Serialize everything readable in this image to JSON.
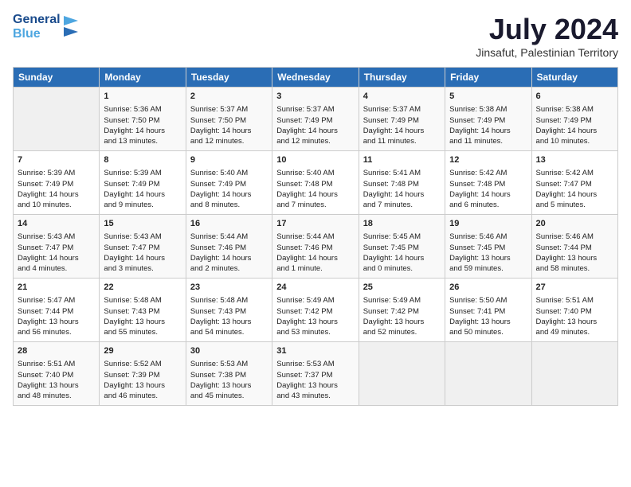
{
  "header": {
    "logo_line1": "General",
    "logo_line2": "Blue",
    "month_year": "July 2024",
    "location": "Jinsafut, Palestinian Territory"
  },
  "days_of_week": [
    "Sunday",
    "Monday",
    "Tuesday",
    "Wednesday",
    "Thursday",
    "Friday",
    "Saturday"
  ],
  "weeks": [
    [
      {
        "day": "",
        "content": ""
      },
      {
        "day": "1",
        "content": "Sunrise: 5:36 AM\nSunset: 7:50 PM\nDaylight: 14 hours\nand 13 minutes."
      },
      {
        "day": "2",
        "content": "Sunrise: 5:37 AM\nSunset: 7:50 PM\nDaylight: 14 hours\nand 12 minutes."
      },
      {
        "day": "3",
        "content": "Sunrise: 5:37 AM\nSunset: 7:49 PM\nDaylight: 14 hours\nand 12 minutes."
      },
      {
        "day": "4",
        "content": "Sunrise: 5:37 AM\nSunset: 7:49 PM\nDaylight: 14 hours\nand 11 minutes."
      },
      {
        "day": "5",
        "content": "Sunrise: 5:38 AM\nSunset: 7:49 PM\nDaylight: 14 hours\nand 11 minutes."
      },
      {
        "day": "6",
        "content": "Sunrise: 5:38 AM\nSunset: 7:49 PM\nDaylight: 14 hours\nand 10 minutes."
      }
    ],
    [
      {
        "day": "7",
        "content": "Sunrise: 5:39 AM\nSunset: 7:49 PM\nDaylight: 14 hours\nand 10 minutes."
      },
      {
        "day": "8",
        "content": "Sunrise: 5:39 AM\nSunset: 7:49 PM\nDaylight: 14 hours\nand 9 minutes."
      },
      {
        "day": "9",
        "content": "Sunrise: 5:40 AM\nSunset: 7:49 PM\nDaylight: 14 hours\nand 8 minutes."
      },
      {
        "day": "10",
        "content": "Sunrise: 5:40 AM\nSunset: 7:48 PM\nDaylight: 14 hours\nand 7 minutes."
      },
      {
        "day": "11",
        "content": "Sunrise: 5:41 AM\nSunset: 7:48 PM\nDaylight: 14 hours\nand 7 minutes."
      },
      {
        "day": "12",
        "content": "Sunrise: 5:42 AM\nSunset: 7:48 PM\nDaylight: 14 hours\nand 6 minutes."
      },
      {
        "day": "13",
        "content": "Sunrise: 5:42 AM\nSunset: 7:47 PM\nDaylight: 14 hours\nand 5 minutes."
      }
    ],
    [
      {
        "day": "14",
        "content": "Sunrise: 5:43 AM\nSunset: 7:47 PM\nDaylight: 14 hours\nand 4 minutes."
      },
      {
        "day": "15",
        "content": "Sunrise: 5:43 AM\nSunset: 7:47 PM\nDaylight: 14 hours\nand 3 minutes."
      },
      {
        "day": "16",
        "content": "Sunrise: 5:44 AM\nSunset: 7:46 PM\nDaylight: 14 hours\nand 2 minutes."
      },
      {
        "day": "17",
        "content": "Sunrise: 5:44 AM\nSunset: 7:46 PM\nDaylight: 14 hours\nand 1 minute."
      },
      {
        "day": "18",
        "content": "Sunrise: 5:45 AM\nSunset: 7:45 PM\nDaylight: 14 hours\nand 0 minutes."
      },
      {
        "day": "19",
        "content": "Sunrise: 5:46 AM\nSunset: 7:45 PM\nDaylight: 13 hours\nand 59 minutes."
      },
      {
        "day": "20",
        "content": "Sunrise: 5:46 AM\nSunset: 7:44 PM\nDaylight: 13 hours\nand 58 minutes."
      }
    ],
    [
      {
        "day": "21",
        "content": "Sunrise: 5:47 AM\nSunset: 7:44 PM\nDaylight: 13 hours\nand 56 minutes."
      },
      {
        "day": "22",
        "content": "Sunrise: 5:48 AM\nSunset: 7:43 PM\nDaylight: 13 hours\nand 55 minutes."
      },
      {
        "day": "23",
        "content": "Sunrise: 5:48 AM\nSunset: 7:43 PM\nDaylight: 13 hours\nand 54 minutes."
      },
      {
        "day": "24",
        "content": "Sunrise: 5:49 AM\nSunset: 7:42 PM\nDaylight: 13 hours\nand 53 minutes."
      },
      {
        "day": "25",
        "content": "Sunrise: 5:49 AM\nSunset: 7:42 PM\nDaylight: 13 hours\nand 52 minutes."
      },
      {
        "day": "26",
        "content": "Sunrise: 5:50 AM\nSunset: 7:41 PM\nDaylight: 13 hours\nand 50 minutes."
      },
      {
        "day": "27",
        "content": "Sunrise: 5:51 AM\nSunset: 7:40 PM\nDaylight: 13 hours\nand 49 minutes."
      }
    ],
    [
      {
        "day": "28",
        "content": "Sunrise: 5:51 AM\nSunset: 7:40 PM\nDaylight: 13 hours\nand 48 minutes."
      },
      {
        "day": "29",
        "content": "Sunrise: 5:52 AM\nSunset: 7:39 PM\nDaylight: 13 hours\nand 46 minutes."
      },
      {
        "day": "30",
        "content": "Sunrise: 5:53 AM\nSunset: 7:38 PM\nDaylight: 13 hours\nand 45 minutes."
      },
      {
        "day": "31",
        "content": "Sunrise: 5:53 AM\nSunset: 7:37 PM\nDaylight: 13 hours\nand 43 minutes."
      },
      {
        "day": "",
        "content": ""
      },
      {
        "day": "",
        "content": ""
      },
      {
        "day": "",
        "content": ""
      }
    ]
  ]
}
